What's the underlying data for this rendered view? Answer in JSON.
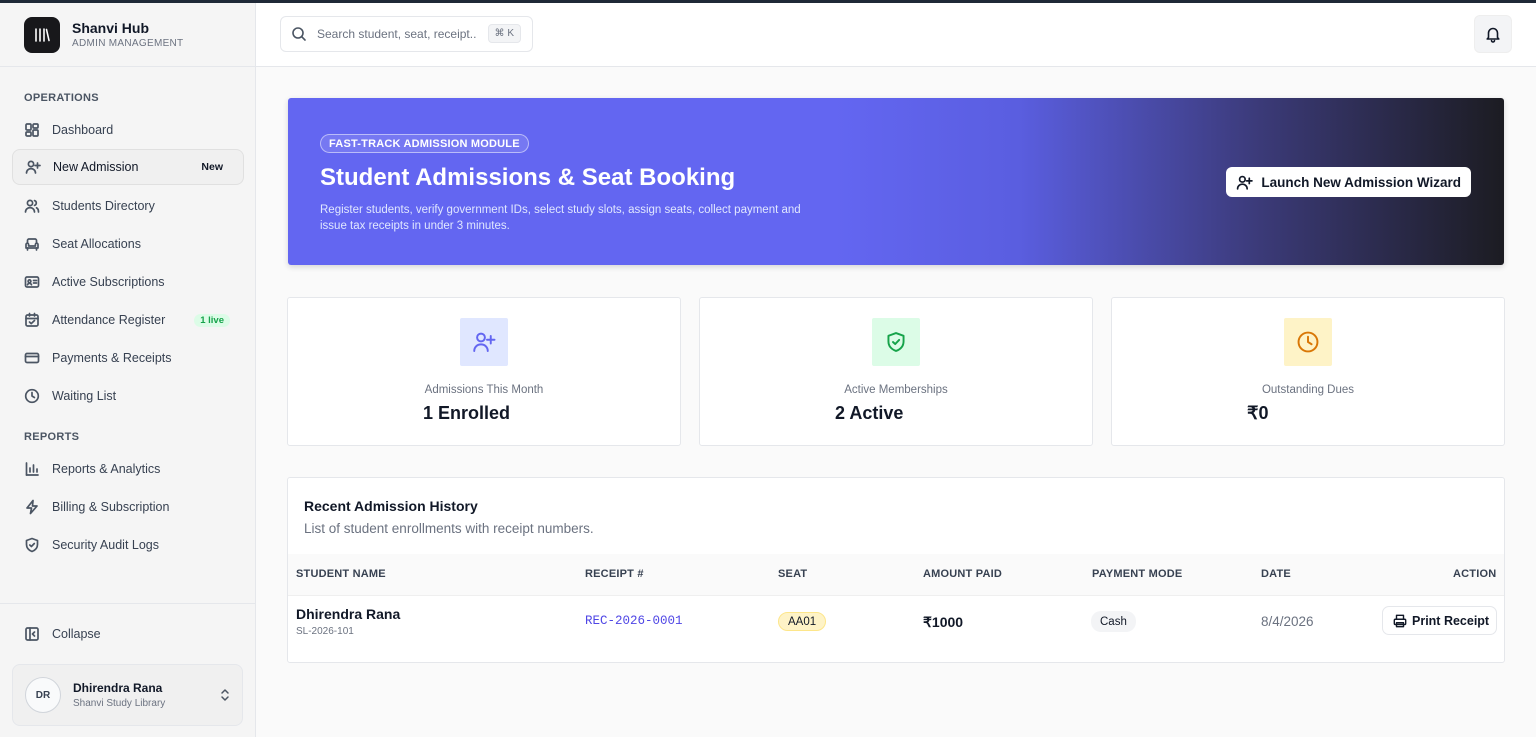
{
  "brand": {
    "title": "Shanvi Hub",
    "subtitle": "ADMIN MANAGEMENT"
  },
  "sidebar": {
    "operations_label": "OPERATIONS",
    "reports_label": "REPORTS",
    "items": [
      {
        "label": "Dashboard",
        "icon": "dashboard-icon"
      },
      {
        "label": "New Admission",
        "icon": "user-plus-icon",
        "badge": "New",
        "active": true
      },
      {
        "label": "Students Directory",
        "icon": "users-icon"
      },
      {
        "label": "Seat Allocations",
        "icon": "armchair-icon"
      },
      {
        "label": "Active Subscriptions",
        "icon": "id-card-icon"
      },
      {
        "label": "Attendance Register",
        "icon": "calendar-check-icon",
        "badge": "1 live"
      },
      {
        "label": "Payments & Receipts",
        "icon": "credit-card-icon"
      },
      {
        "label": "Waiting List",
        "icon": "clock-icon"
      }
    ],
    "report_items": [
      {
        "label": "Reports & Analytics",
        "icon": "bar-chart-icon"
      },
      {
        "label": "Billing & Subscription",
        "icon": "zap-icon"
      },
      {
        "label": "Security Audit Logs",
        "icon": "shield-icon"
      }
    ],
    "collapse_label": "Collapse",
    "user": {
      "initials": "DR",
      "name": "Dhirendra Rana",
      "org": "Shanvi Study Library"
    }
  },
  "header": {
    "search_placeholder": "Search student, seat, receipt...",
    "shortcut": "⌘ K"
  },
  "hero": {
    "tag": "FAST-TRACK ADMISSION MODULE",
    "title": "Student Admissions & Seat Booking",
    "description": "Register students, verify government IDs, select study slots, assign seats, collect payment and issue tax receipts in under 3 minutes.",
    "button": "Launch New Admission Wizard"
  },
  "stats": [
    {
      "label": "Admissions This Month",
      "value": "1 Enrolled",
      "icon": "user-plus-icon",
      "color": "#6366f1"
    },
    {
      "label": "Active Memberships",
      "value": "2 Active",
      "icon": "shield-check-icon",
      "color": "#16a34a"
    },
    {
      "label": "Outstanding Dues",
      "value": "₹0",
      "icon": "clock-icon",
      "color": "#d97706"
    }
  ],
  "history": {
    "title": "Recent Admission History",
    "subtitle": "List of student enrollments with receipt numbers.",
    "columns": [
      "STUDENT NAME",
      "RECEIPT #",
      "SEAT",
      "AMOUNT PAID",
      "PAYMENT MODE",
      "DATE",
      "ACTION"
    ],
    "rows": [
      {
        "name": "Dhirendra Rana",
        "student_id": "SL-2026-101",
        "receipt": "REC-2026-0001",
        "seat": "AA01",
        "amount": "₹1000",
        "mode": "Cash",
        "date": "8/4/2026",
        "action": "Print Receipt"
      }
    ]
  }
}
